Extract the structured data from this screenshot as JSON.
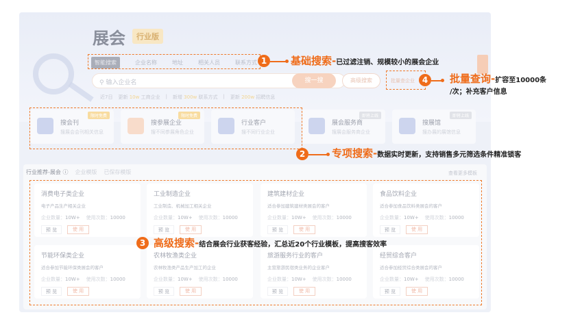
{
  "header": {
    "title": "展会",
    "edition": "行业版"
  },
  "tabs": [
    "智能搜索",
    "企业名称",
    "地址",
    "相关人员",
    "联系方式"
  ],
  "search": {
    "placeholder": "输入企业名",
    "submit": "搜一搜",
    "advanced": "高级搜索",
    "batch": "批量查企业"
  },
  "stats": {
    "period": "近7日",
    "s1_pre": "更新",
    "s1_val": "10w",
    "s1_post": "工商企业",
    "s2_pre": "新增",
    "s2_val": "300w",
    "s2_post": "联系方式",
    "s3_pre": "更新",
    "s3_val": "200w",
    "s3_post": "招聘信息",
    "sep": "|"
  },
  "features": [
    {
      "name": "搜会刊",
      "desc": "搜展会会刊相关信息",
      "tag": "限时免费"
    },
    {
      "name": "搜参展企业",
      "desc": "搜不同参展角色企业",
      "tag": "限时免费"
    },
    {
      "name": "行业客户",
      "desc": "搜不同行业企业",
      "tag": ""
    },
    {
      "name": "展会服务商",
      "desc": "搜展会服务商企业",
      "tag": "即将上线"
    },
    {
      "name": "搜展馆",
      "desc": "搜办展的展馆信息",
      "tag": "即将上线"
    }
  ],
  "templates": {
    "title": "行业推荐-展会",
    "info_icon": "ⓘ",
    "tab2": "企业模版",
    "tab3": "已保存模版",
    "more": "查看更多模板",
    "count_label": "企业数量：",
    "usage_label": "使用次数：",
    "preview": "预 览",
    "use": "使 用",
    "cards": [
      {
        "name": "消费电子类企业",
        "desc": "电子产品生产相关企业",
        "count": "10W+",
        "usage": "10000"
      },
      {
        "name": "工业制造企业",
        "desc": "工业制造、机械加工相关企业",
        "count": "10W+",
        "usage": "10000"
      },
      {
        "name": "建筑建材企业",
        "desc": "适合参加建筑建材类展会的客户",
        "count": "10W+",
        "usage": "10000"
      },
      {
        "name": "食品饮料企业",
        "desc": "适合参加食品饮料类展会的客户",
        "count": "10W+",
        "usage": "10000"
      },
      {
        "name": "节能环保类企业",
        "desc": "适合参加节能环保类展会的客户",
        "count": "10W+",
        "usage": "10000"
      },
      {
        "name": "农林牧渔类企业",
        "desc": "农林牧渔类产品生产加工的企业",
        "count": "10W+",
        "usage": "10000"
      },
      {
        "name": "旅游服务行业的客户",
        "desc": "主营旅游民宿类业务的企业客户",
        "count": "10W+",
        "usage": "10000"
      },
      {
        "name": "经贸综合客户",
        "desc": "适合参加经贸综合类展会的客户",
        "count": "10W+",
        "usage": "10000"
      }
    ]
  },
  "annotations": [
    {
      "num": "1",
      "title": "基础搜索-",
      "text": "已过滤注销、规模较小的展会企业"
    },
    {
      "num": "2",
      "title": "专项搜索-",
      "text": "数据实时更新，支持销售多元筛选条件精准锁客"
    },
    {
      "num": "3",
      "title": "高级搜索-",
      "text": "结合展会行业获客经验，汇总近20个行业模板，提高搜客效率"
    },
    {
      "num": "4",
      "title": "批量查询-",
      "text": "扩容至10000条",
      "text2": "/次；补充客户信息"
    }
  ],
  "colors": {
    "accent": "#ef6c1a"
  }
}
